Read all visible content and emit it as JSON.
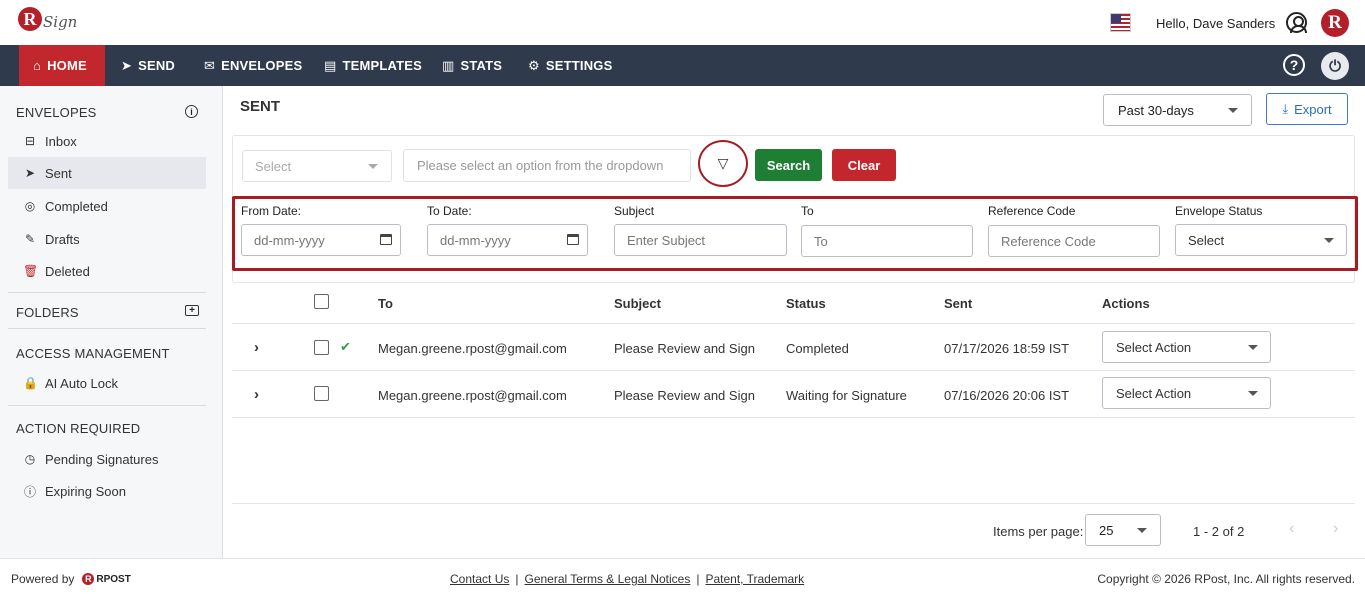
{
  "header": {
    "logo_letter": "R",
    "logo_text": "Sign",
    "greeting": "Hello, Dave Sanders",
    "brand_letter": "R"
  },
  "nav": {
    "items": [
      {
        "label": "HOME",
        "icon": "home-icon"
      },
      {
        "label": "SEND",
        "icon": "send-icon"
      },
      {
        "label": "ENVELOPES",
        "icon": "envelope-icon"
      },
      {
        "label": "TEMPLATES",
        "icon": "document-icon"
      },
      {
        "label": "STATS",
        "icon": "bar-chart-icon"
      },
      {
        "label": "SETTINGS",
        "icon": "gear-icon"
      }
    ],
    "help_glyph": "?",
    "active_color": "#c1272d",
    "bar_color": "#2f3b4c"
  },
  "sidebar": {
    "envelopes_heading": "ENVELOPES",
    "envelope_items": [
      {
        "label": "Inbox",
        "icon": "inbox-icon"
      },
      {
        "label": "Sent",
        "icon": "send-icon"
      },
      {
        "label": "Completed",
        "icon": "check-circle-icon"
      },
      {
        "label": "Drafts",
        "icon": "edit-icon"
      },
      {
        "label": "Deleted",
        "icon": "trash-icon"
      }
    ],
    "folders_heading": "FOLDERS",
    "access_heading": "ACCESS MANAGEMENT",
    "access_items": [
      {
        "label": "AI Auto Lock",
        "icon": "lock-icon"
      }
    ],
    "action_heading": "ACTION REQUIRED",
    "action_items": [
      {
        "label": "Pending Signatures",
        "icon": "clock-icon"
      },
      {
        "label": "Expiring Soon",
        "icon": "alert-icon"
      }
    ]
  },
  "main": {
    "title": "SENT",
    "period": "Past 30-days",
    "export_label": "Export"
  },
  "search": {
    "select_placeholder": "Select",
    "input_placeholder": "Please select an option from the dropdown",
    "search_label": "Search",
    "clear_label": "Clear"
  },
  "advanced": {
    "from_date_label": "From Date:",
    "from_date_placeholder": "dd-mm-yyyy",
    "to_date_label": "To Date:",
    "to_date_placeholder": "dd-mm-yyyy",
    "subject_label": "Subject",
    "subject_placeholder": "Enter Subject",
    "to_label": "To",
    "to_placeholder": "To",
    "reference_label": "Reference Code",
    "reference_placeholder": "Reference Code",
    "status_label": "Envelope Status",
    "status_value": "Select"
  },
  "table": {
    "columns": [
      "To",
      "Subject",
      "Status",
      "Sent",
      "Actions"
    ],
    "rows": [
      {
        "to": "Megan.greene.rpost@gmail.com",
        "subject": "Please Review and Sign",
        "status": "Completed",
        "sent": "07/17/2026 18:59 IST",
        "action": "Select Action",
        "completed": true
      },
      {
        "to": "Megan.greene.rpost@gmail.com",
        "subject": "Please Review and Sign",
        "status": "Waiting for Signature",
        "sent": "07/16/2026 20:06 IST",
        "action": "Select Action",
        "completed": false
      }
    ]
  },
  "pagination": {
    "items_per_page_label": "Items per page:",
    "items_per_page": "25",
    "range": "1 - 2 of 2"
  },
  "footer": {
    "powered_by": "Powered by",
    "rpost_brand": "RPOST",
    "links": [
      "Contact Us",
      "General Terms & Legal Notices",
      "Patent, Trademark"
    ],
    "separator": "|",
    "copyright": "Copyright © 2026 RPost, Inc. All rights reserved."
  }
}
